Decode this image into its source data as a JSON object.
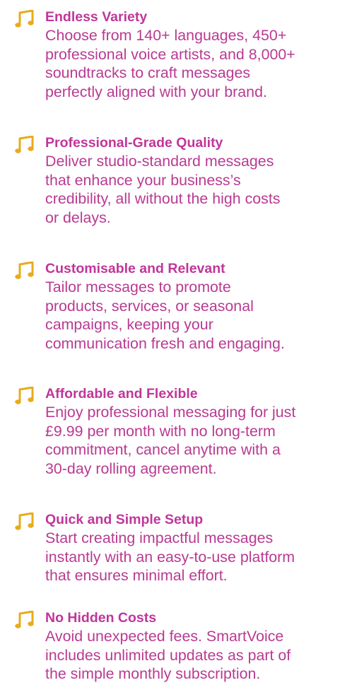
{
  "colors": {
    "title": "#c0369a",
    "description": "#b93a92",
    "icon": "#e7ab1c"
  },
  "features": {
    "items": [
      {
        "icon": "music-note-icon",
        "title": "Endless Variety",
        "lines": [
          "Choose from 140+ languages, 450+",
          "professional voice artists, and 8,000+",
          "soundtracks to craft messages",
          "perfectly aligned with your brand."
        ]
      },
      {
        "icon": "music-note-icon",
        "title": "Professional-Grade Quality",
        "lines": [
          "Deliver studio-standard messages",
          "that enhance your business’s",
          "credibility, all without the high costs",
          "or delays."
        ]
      },
      {
        "icon": "music-note-icon",
        "title": "Customisable and Relevant",
        "lines": [
          "Tailor messages to promote",
          "products, services, or seasonal",
          "campaigns, keeping your",
          "communication fresh and engaging."
        ]
      },
      {
        "icon": "music-note-icon",
        "title": "Affordable and Flexible",
        "lines": [
          "Enjoy professional messaging for just",
          "£9.99 per month with no long-term",
          "commitment, cancel anytime with a",
          "30-day rolling agreement."
        ]
      },
      {
        "icon": "music-note-icon",
        "title": "Quick and Simple Setup",
        "lines": [
          "Start creating impactful messages",
          "instantly with an easy-to-use platform",
          "that ensures minimal effort."
        ]
      },
      {
        "icon": "music-note-icon",
        "title": "No Hidden Costs",
        "lines": [
          "Avoid unexpected fees. SmartVoice",
          "includes unlimited updates as part of",
          "the simple monthly subscription."
        ]
      }
    ]
  }
}
